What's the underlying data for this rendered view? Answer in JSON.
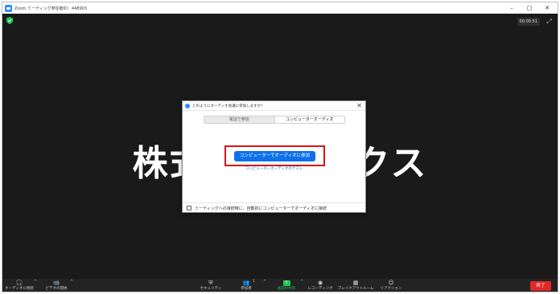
{
  "window": {
    "title": "Zoom ミーティング参加者ID：448903",
    "minimize": "–",
    "maximize": "□",
    "close": "✕"
  },
  "meeting": {
    "timer": "00:00:51",
    "participant_name": "株式会社ワークス",
    "fullscreen_icon": "fullscreen-icon"
  },
  "dialog": {
    "title": "どのようにオーディオ会議に参加しますか?",
    "close": "✕",
    "tabs": [
      {
        "label": "電話で参加"
      },
      {
        "label": "コンピューターオーディオ"
      }
    ],
    "join_button": "コンピューターでオーディオに参加",
    "test_link": "コンピューターオーディオのテスト",
    "auto_join_label": "ミーティングへの接続時に、自動的にコンピューターでオーディオに接続",
    "highlight_color": "#d71518",
    "accent_color": "#0e71eb"
  },
  "toolbar": {
    "audio": "オーディオに接続",
    "video": "ビデオの開始",
    "security": "セキュリティ",
    "participants": "参加者",
    "participants_count": "1",
    "share": "画面の共有",
    "record": "レコーディング",
    "breakout": "ブレイクアウトルーム",
    "reactions": "リアクション",
    "end": "終了",
    "caret": "^"
  }
}
